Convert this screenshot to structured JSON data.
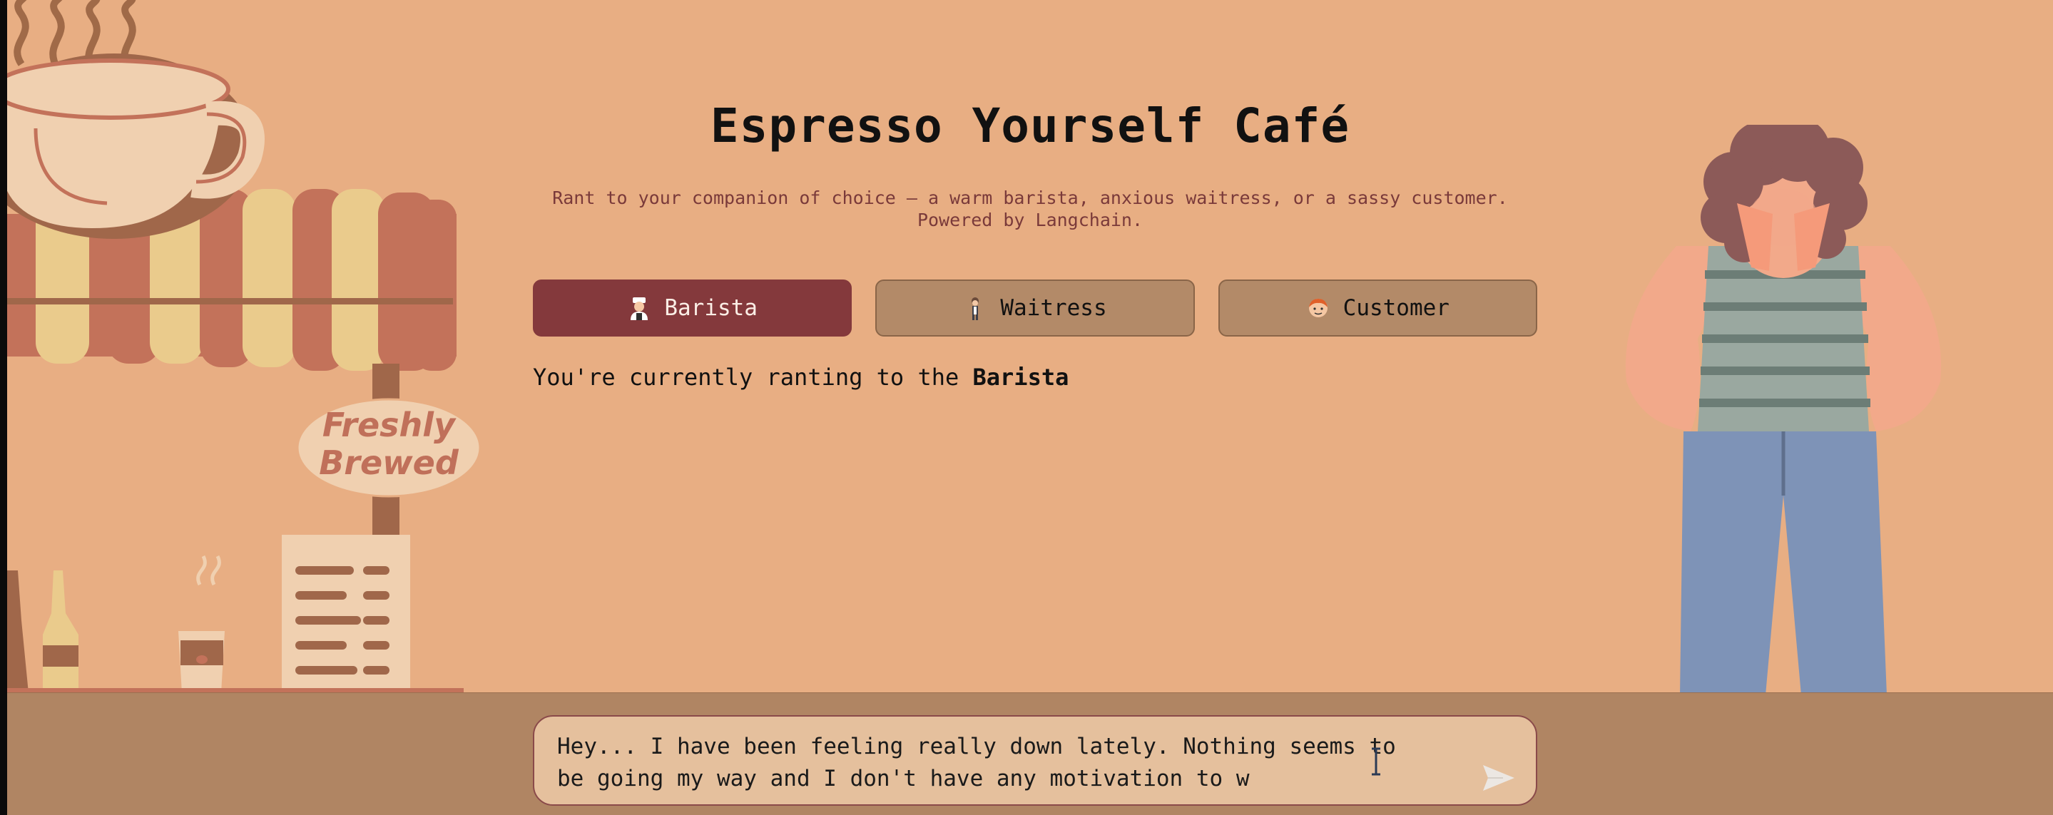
{
  "app": {
    "title": "Espresso Yourself Café",
    "subtitle_line1": "Rant to your companion of choice — a warm barista, anxious waitress, or a sassy customer.",
    "subtitle_line2": "Powered by Langchain."
  },
  "roles": [
    {
      "label": "Barista",
      "icon": "barista-emoji",
      "active": true
    },
    {
      "label": "Waitress",
      "icon": "waitress-emoji",
      "active": false
    },
    {
      "label": "Customer",
      "icon": "customer-emoji",
      "active": false
    }
  ],
  "status": {
    "prefix": "You're currently ranting to the ",
    "current": "Barista"
  },
  "chat": {
    "value": "Hey... I have been feeling really down lately. Nothing seems to be going my way and I don't have any motivation to w"
  },
  "illustrations": {
    "sign_line1": "Freshly",
    "sign_line2": "Brewed"
  },
  "colors": {
    "background": "#e8ae83",
    "active_button": "#84393c",
    "inactive_button": "#b38a68",
    "floor": "#b08563",
    "input": "#e5c09d"
  }
}
